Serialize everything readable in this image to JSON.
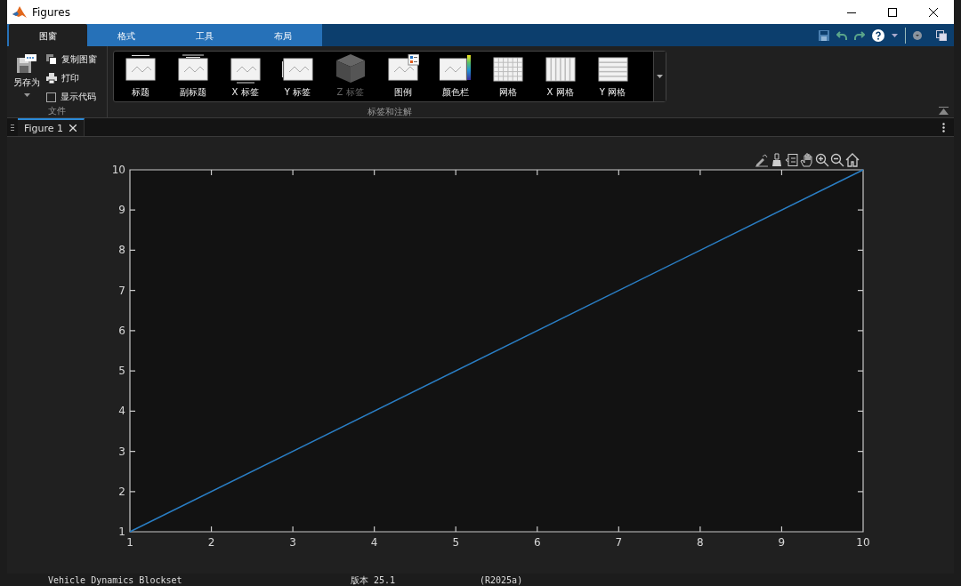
{
  "window": {
    "title": "Figures"
  },
  "toolstrip_tabs": [
    {
      "label": "图窗",
      "selected": true
    },
    {
      "label": "格式",
      "selected": false
    },
    {
      "label": "工具",
      "selected": false
    },
    {
      "label": "布局",
      "selected": false
    }
  ],
  "file_group": {
    "label": "文件",
    "save_as": "另存为",
    "copy_figure": "复制图窗",
    "print": "打印",
    "show_code": {
      "label": "显示代码",
      "checked": false
    }
  },
  "annotation_group": {
    "label": "标签和注解",
    "items": [
      {
        "label": "标题",
        "kind": "title",
        "disabled": false
      },
      {
        "label": "副标题",
        "kind": "subtitle",
        "disabled": false
      },
      {
        "label": "X 标签",
        "kind": "xlabel",
        "disabled": false
      },
      {
        "label": "Y 标签",
        "kind": "ylabel",
        "disabled": false
      },
      {
        "label": "Z 标签",
        "kind": "zlabel",
        "disabled": true
      },
      {
        "label": "图例",
        "kind": "legend",
        "disabled": false
      },
      {
        "label": "颜色栏",
        "kind": "colorbar",
        "disabled": false
      },
      {
        "label": "网格",
        "kind": "grid",
        "disabled": false
      },
      {
        "label": "X 网格",
        "kind": "xgrid",
        "disabled": false
      },
      {
        "label": "Y 网格",
        "kind": "ygrid",
        "disabled": false
      }
    ]
  },
  "figure_tabs": [
    {
      "label": "Figure 1",
      "selected": true
    }
  ],
  "plot": {
    "chart_data": {
      "type": "line",
      "x": [
        1,
        10
      ],
      "series": [
        {
          "color": "#2a7ec4",
          "values": [
            1,
            10
          ]
        }
      ],
      "xlim": [
        1,
        10
      ],
      "ylim": [
        1,
        10
      ],
      "xticks": [
        1,
        2,
        3,
        4,
        5,
        6,
        7,
        8,
        9,
        10
      ],
      "yticks": [
        1,
        2,
        3,
        4,
        5,
        6,
        7,
        8,
        9,
        10
      ]
    }
  },
  "background_window": {
    "row": [
      "Vehicle Dynamics Blockset",
      "版本 25.1",
      "(R2025a)"
    ]
  }
}
